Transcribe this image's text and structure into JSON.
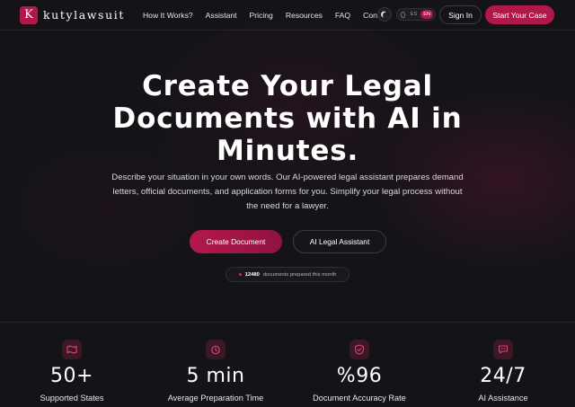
{
  "brand": {
    "logo_letter": "K",
    "name": "kutylawsuit"
  },
  "nav": {
    "links": [
      "How It Works?",
      "Assistant",
      "Pricing",
      "Resources",
      "FAQ",
      "Contact"
    ],
    "language": {
      "options": [
        "ES",
        "EN"
      ],
      "selected": "EN"
    },
    "signin_label": "Sign In",
    "cta_label": "Start Your Case"
  },
  "hero": {
    "title_lines": [
      "Create Your Legal",
      "Documents with AI in",
      "Minutes."
    ],
    "description_lines": [
      "Describe your situation in your own words. Our AI-powered legal assistant prepares demand",
      "letters, official documents, and application forms for you. Simplify your legal process without",
      "the need for a lawyer."
    ],
    "primary_button": "Create Document",
    "secondary_button": "AI Legal Assistant",
    "counter": {
      "value": "12480",
      "label": "documents prepared this month"
    }
  },
  "stats": [
    {
      "value": "50+",
      "label": "Supported States",
      "icon": "map-icon"
    },
    {
      "value": "5 min",
      "label": "Average Preparation Time",
      "icon": "clock-icon"
    },
    {
      "value": "%96",
      "label": "Document Accuracy Rate",
      "icon": "shield-check-icon"
    },
    {
      "value": "24/7",
      "label": "AI Assistance",
      "icon": "chat-icon"
    }
  ],
  "colors": {
    "background": "#131318",
    "accent": "#b1184a",
    "icon_tile": "#3a1826",
    "icon_color": "#e0406e"
  }
}
